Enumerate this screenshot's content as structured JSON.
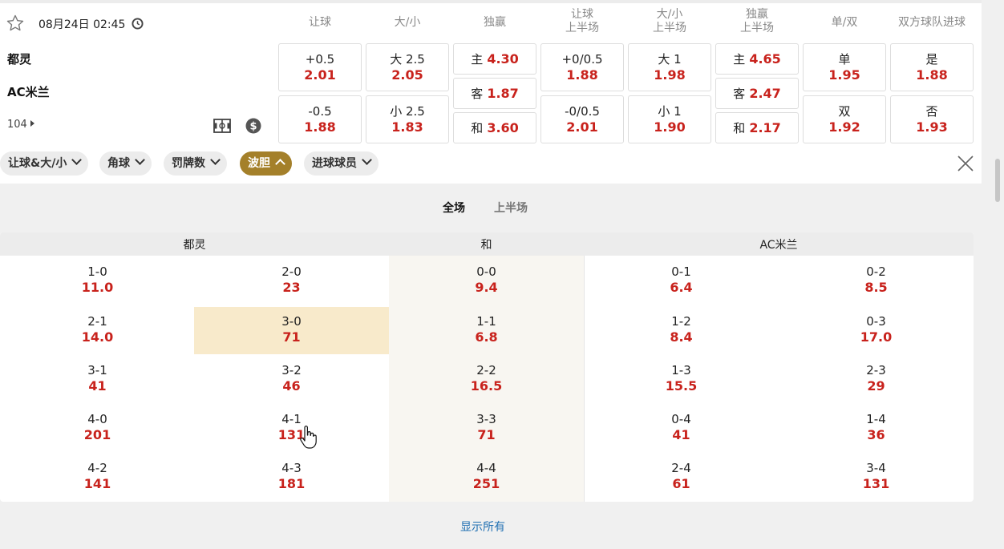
{
  "match": {
    "datetime": "08月24日 02:45",
    "home": "都灵",
    "away": "AC米兰",
    "more_markets": "104"
  },
  "columns": [
    {
      "line1": "让球",
      "line2": ""
    },
    {
      "line1": "大/小",
      "line2": ""
    },
    {
      "line1": "独赢",
      "line2": ""
    },
    {
      "line1": "让球",
      "line2": "上半场"
    },
    {
      "line1": "大/小",
      "line2": "上半场"
    },
    {
      "line1": "独赢",
      "line2": "上半场"
    },
    {
      "line1": "单/双",
      "line2": ""
    },
    {
      "line1": "双方球队进球",
      "line2": ""
    }
  ],
  "odds": {
    "handicap": [
      {
        "label": "+0.5",
        "odd": "2.01"
      },
      {
        "label": "-0.5",
        "odd": "1.88"
      }
    ],
    "over_under": [
      {
        "label": "大 2.5",
        "odd": "2.05"
      },
      {
        "label": "小 2.5",
        "odd": "1.83"
      }
    ],
    "moneyline": [
      {
        "label": "主",
        "odd": "4.30"
      },
      {
        "label": "客",
        "odd": "1.87"
      },
      {
        "label": "和",
        "odd": "3.60"
      }
    ],
    "handicap_1h": [
      {
        "label": "+0/0.5",
        "odd": "1.88"
      },
      {
        "label": "-0/0.5",
        "odd": "2.01"
      }
    ],
    "over_under_1h": [
      {
        "label": "大 1",
        "odd": "1.98"
      },
      {
        "label": "小 1",
        "odd": "1.90"
      }
    ],
    "moneyline_1h": [
      {
        "label": "主",
        "odd": "4.65"
      },
      {
        "label": "客",
        "odd": "2.47"
      },
      {
        "label": "和",
        "odd": "2.17"
      }
    ],
    "odd_even": [
      {
        "label": "单",
        "odd": "1.95"
      },
      {
        "label": "双",
        "odd": "1.92"
      }
    ],
    "btts": [
      {
        "label": "是",
        "odd": "1.88"
      },
      {
        "label": "否",
        "odd": "1.93"
      }
    ]
  },
  "filters": [
    {
      "label": "让球&大/小",
      "active": false
    },
    {
      "label": "角球",
      "active": false
    },
    {
      "label": "罚牌数",
      "active": false
    },
    {
      "label": "波胆",
      "active": true
    },
    {
      "label": "进球球员",
      "active": false
    }
  ],
  "period_tabs": [
    {
      "label": "全场",
      "active": true
    },
    {
      "label": "上半场",
      "active": false
    }
  ],
  "correct_score": {
    "headers": {
      "home": "都灵",
      "draw": "和",
      "away": "AC米兰"
    },
    "rows": [
      [
        {
          "s": "1-0",
          "o": "11.0"
        },
        {
          "s": "2-0",
          "o": "23"
        },
        {
          "s": "0-0",
          "o": "9.4"
        },
        {
          "s": "0-1",
          "o": "6.4"
        },
        {
          "s": "0-2",
          "o": "8.5"
        }
      ],
      [
        {
          "s": "2-1",
          "o": "14.0"
        },
        {
          "s": "3-0",
          "o": "71"
        },
        {
          "s": "1-1",
          "o": "6.8"
        },
        {
          "s": "1-2",
          "o": "8.4"
        },
        {
          "s": "0-3",
          "o": "17.0"
        }
      ],
      [
        {
          "s": "3-1",
          "o": "41"
        },
        {
          "s": "3-2",
          "o": "46"
        },
        {
          "s": "2-2",
          "o": "16.5"
        },
        {
          "s": "1-3",
          "o": "15.5"
        },
        {
          "s": "2-3",
          "o": "29"
        }
      ],
      [
        {
          "s": "4-0",
          "o": "201"
        },
        {
          "s": "4-1",
          "o": "131"
        },
        {
          "s": "3-3",
          "o": "71"
        },
        {
          "s": "0-4",
          "o": "41"
        },
        {
          "s": "1-4",
          "o": "36"
        }
      ],
      [
        {
          "s": "4-2",
          "o": "141"
        },
        {
          "s": "4-3",
          "o": "181"
        },
        {
          "s": "4-4",
          "o": "251"
        },
        {
          "s": "2-4",
          "o": "61"
        },
        {
          "s": "3-4",
          "o": "131"
        }
      ]
    ],
    "show_all": "显示所有"
  },
  "colors": {
    "accent": "#a4802a",
    "odds": "#c8221c",
    "highlight": "#f8eacb",
    "link": "#1f6fb2"
  }
}
